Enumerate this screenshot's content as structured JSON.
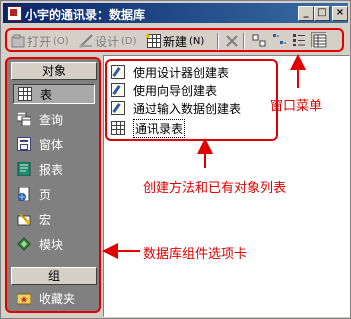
{
  "window": {
    "title": "小宇的通讯录：数据库",
    "buttons": {
      "minimize": "_",
      "maximize": "□",
      "close": "×"
    }
  },
  "toolbar": {
    "open": "打开",
    "open_key": "(O)",
    "design": "设计",
    "design_key": "(D)",
    "new": "新建",
    "new_key": "(N)"
  },
  "sidebar": {
    "objects_header": "对象",
    "items": [
      {
        "label": "表",
        "icon": "table-icon"
      },
      {
        "label": "查询",
        "icon": "query-icon"
      },
      {
        "label": "窗体",
        "icon": "form-icon"
      },
      {
        "label": "报表",
        "icon": "report-icon"
      },
      {
        "label": "页",
        "icon": "page-icon"
      },
      {
        "label": "宏",
        "icon": "macro-icon"
      },
      {
        "label": "模块",
        "icon": "module-icon"
      }
    ],
    "groups_header": "组",
    "favorites": "收藏夹"
  },
  "list": {
    "items": [
      {
        "label": "使用设计器创建表",
        "icon": "design-wizard-icon"
      },
      {
        "label": "使用向导创建表",
        "icon": "wizard-icon"
      },
      {
        "label": "通过输入数据创建表",
        "icon": "data-entry-icon"
      },
      {
        "label": "通讯录表",
        "icon": "table-icon"
      }
    ]
  },
  "annotations": {
    "window_menu": "窗口菜单",
    "list_note": "创建方法和已有对象列表",
    "tabs_note": "数据库组件选项卡"
  },
  "colors": {
    "annotation": "#e00000",
    "titlebar": "#0a246a",
    "sidebar": "#808080"
  }
}
